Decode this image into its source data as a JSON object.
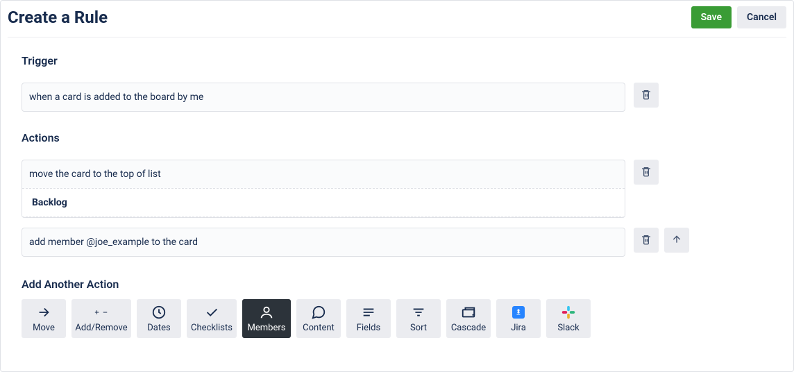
{
  "header": {
    "title": "Create a Rule",
    "save_label": "Save",
    "cancel_label": "Cancel"
  },
  "trigger": {
    "section_title": "Trigger",
    "text": "when a card is added to the board by me"
  },
  "actions": {
    "section_title": "Actions",
    "items": [
      {
        "text": "move the card to the top of list",
        "sub": "Backlog"
      },
      {
        "text": "add member @joe_example to the card"
      }
    ]
  },
  "add_another": {
    "title": "Add Another Action",
    "tiles": {
      "move": "Move",
      "add_remove": "Add/Remove",
      "dates": "Dates",
      "checklists": "Checklists",
      "members": "Members",
      "content": "Content",
      "fields": "Fields",
      "sort": "Sort",
      "cascade": "Cascade",
      "jira": "Jira",
      "slack": "Slack"
    }
  }
}
